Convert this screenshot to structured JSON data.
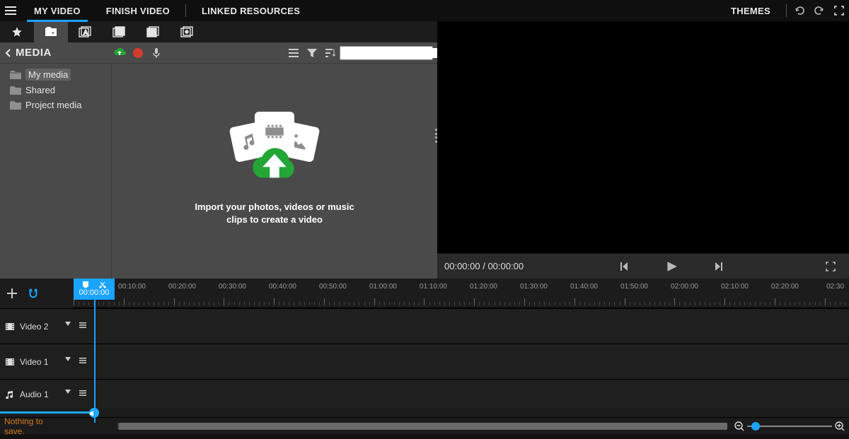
{
  "topnav": {
    "tabs": [
      "MY VIDEO",
      "FINISH VIDEO",
      "LINKED RESOURCES"
    ],
    "themes_label": "THEMES"
  },
  "media": {
    "title": "MEDIA",
    "tree": [
      "My media",
      "Shared",
      "Project media"
    ],
    "import_line1": "Import your photos, videos or music",
    "import_line2": "clips to create a video",
    "search_placeholder": ""
  },
  "preview": {
    "time_current": "00:00:00",
    "time_total": "00:00:00"
  },
  "timeline": {
    "playhead": "00:00:00",
    "ruler": [
      "00:10:00",
      "00:20:00",
      "00:30:00",
      "00:40:00",
      "00:50:00",
      "01:00:00",
      "01:10:00",
      "01:20:00",
      "01:30:00",
      "01:40:00",
      "01:50:00",
      "02:00:00",
      "02:10:00",
      "02:20:00",
      "02:30"
    ],
    "tracks": [
      "Video 2",
      "Video 1",
      "Audio 1"
    ]
  },
  "status": {
    "message": "Nothing to save."
  }
}
